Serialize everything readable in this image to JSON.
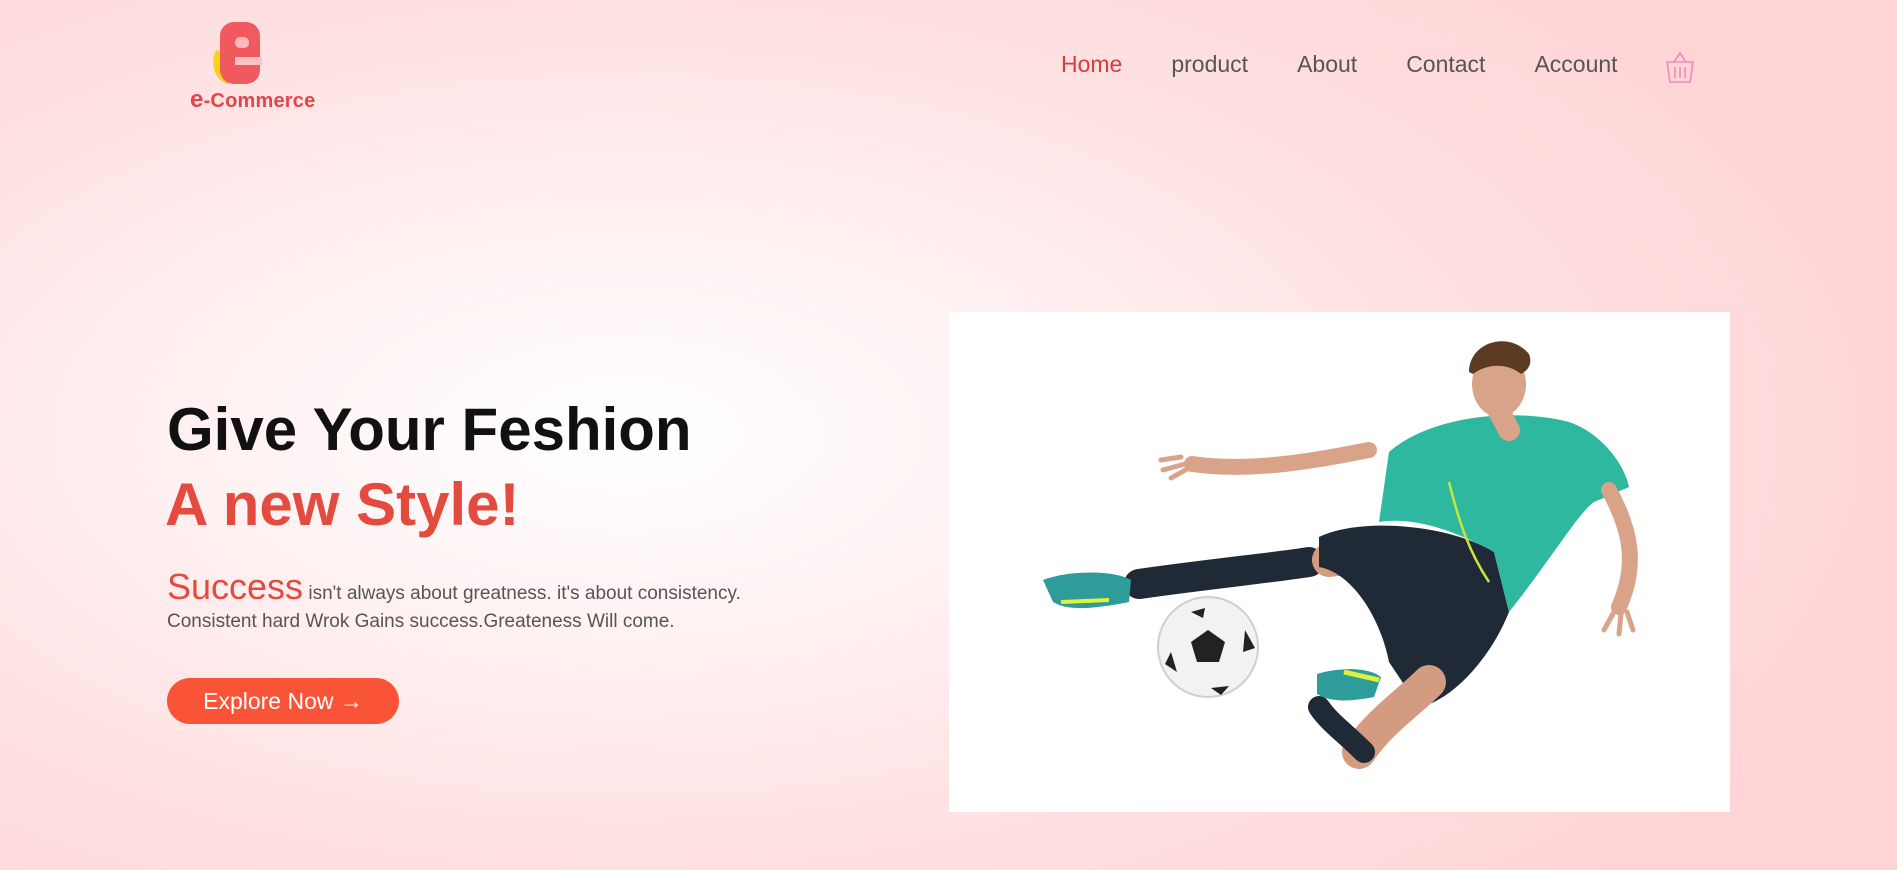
{
  "brand": {
    "logo_text": "-Commerce",
    "logo_letter": "e"
  },
  "nav": {
    "home": "Home",
    "product": "product",
    "about": "About",
    "contact": "Contact",
    "account": "Account"
  },
  "hero": {
    "title": "Give Your Feshion",
    "subtitle": "A new Style!",
    "highlight": "Success",
    "description": " isn't always about greatness. it's about consistency. Consistent hard Wrok Gains success.Greateness Will come.",
    "cta": "Explore Now →"
  },
  "colors": {
    "accent": "#e34b3e",
    "button": "#fa5438",
    "nav_active": "#d63c3c"
  },
  "icons": {
    "cart": "basket-icon"
  }
}
